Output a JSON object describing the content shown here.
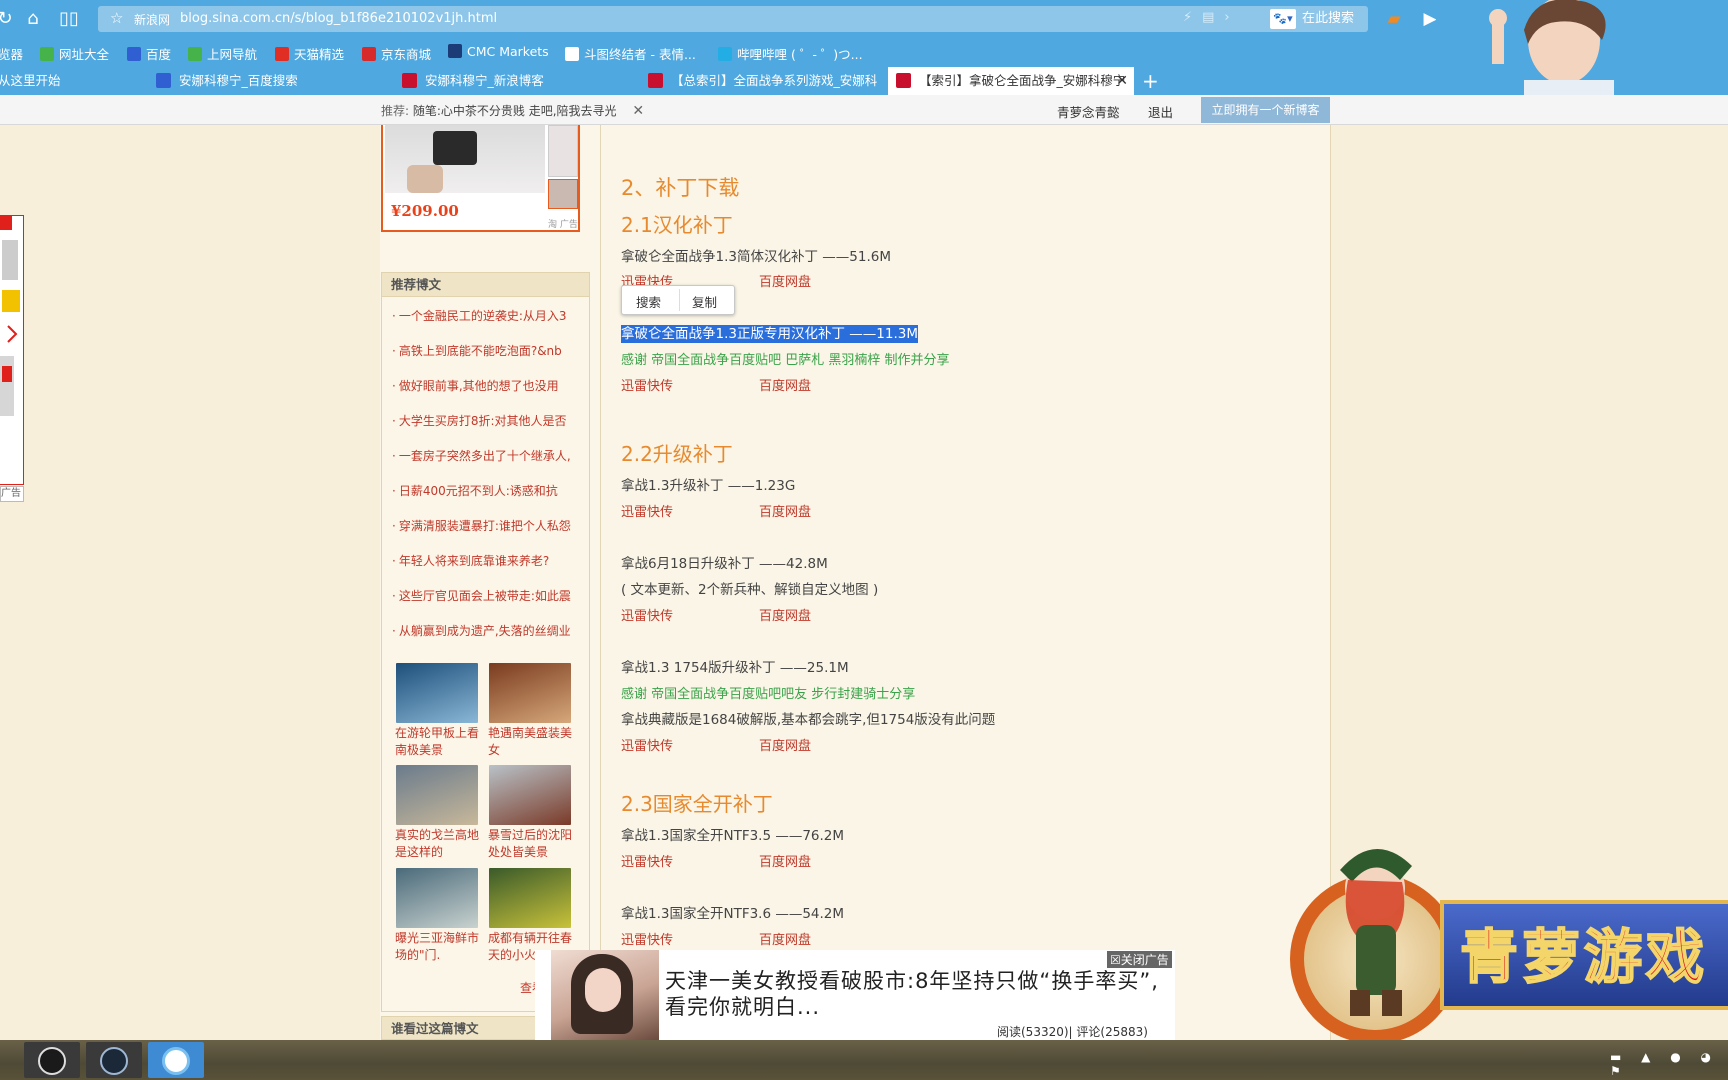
{
  "browser": {
    "address": {
      "site_label": "新浪网",
      "url": "blog.sina.com.cn/s/blog_b1f86e210102v1jh.html"
    },
    "search": {
      "placeholder": "在此搜索"
    },
    "bookmarks": [
      {
        "label": "览器",
        "icon": "doc-icon",
        "color": "#ffffff"
      },
      {
        "label": "网址大全",
        "icon": "leaf-icon",
        "color": "#46b34a"
      },
      {
        "label": "百度",
        "icon": "baidu-paw-icon",
        "color": "#2f5fd0"
      },
      {
        "label": "上网导航",
        "icon": "leaf-icon",
        "color": "#46b34a"
      },
      {
        "label": "天猫精选",
        "icon": "tmall-icon",
        "color": "#e02e24"
      },
      {
        "label": "京东商城",
        "icon": "jd-icon",
        "color": "#d72b2b"
      },
      {
        "label": "CMC Markets",
        "icon": "chart-icon",
        "color": "#1c3c78"
      },
      {
        "label": "斗图终结者 - 表情...",
        "icon": "doutu-icon",
        "color": "#ffffff"
      },
      {
        "label": "哔哩哔哩 ( ゜- ゜)つ...",
        "icon": "bilibili-icon",
        "color": "#23ade5"
      }
    ],
    "tabs": [
      {
        "label": "从这里开始",
        "icon": "",
        "color": ""
      },
      {
        "label": "安娜科穆宁_百度搜索",
        "icon": "baidu-paw-icon",
        "color": "#2f5fd0"
      },
      {
        "label": "安娜科穆宁_新浪博客",
        "icon": "sina-icon",
        "color": "#c8102e"
      },
      {
        "label": "【总索引】全面战争系列游戏_安娜科",
        "icon": "sina-icon",
        "color": "#c8102e"
      },
      {
        "label": "【索引】拿破仑全面战争_安娜科穆宁",
        "icon": "sina-icon",
        "color": "#c8102e"
      }
    ]
  },
  "blog_bar": {
    "recommend_prefix": "推荐:",
    "recommend_text": "随笔:心中茶不分贵贱  走吧,陪我去寻光",
    "username": "青萝念青懿",
    "logout": "退出",
    "new_blog": "立即拥有一个新博客"
  },
  "sidebar": {
    "product_price": "¥209.00",
    "product_tag": "淘 广告",
    "left_ad_label": "广告",
    "rec_header": "推荐博文",
    "rec_items": [
      "一个金融民工的逆袭史:从月入3",
      "高铁上到底能不能吃泡面?&nb",
      "做好眼前事,其他的想了也没用",
      "大学生买房打8折:对其他人是否",
      "一套房子突然多出了十个继承人,",
      "日薪400元招不到人:诱惑和抗",
      "穿满清服装遭暴打:谁把个人私怨",
      "年轻人将来到底靠谁来养老?",
      "这些厅官见面会上被带走:如此震",
      "从躺赢到成为遗产,失落的丝绸业"
    ],
    "thumbs": [
      {
        "caption": "在游轮甲板上看南极美景",
        "colors": [
          "#1d4f7a",
          "#8ab7d6"
        ]
      },
      {
        "caption": "艳遇南美盛装美女",
        "colors": [
          "#7a3b1f",
          "#d6a87a"
        ]
      },
      {
        "caption": "真实的戈兰高地是这样的",
        "colors": [
          "#6a7b8c",
          "#c8b89a"
        ]
      },
      {
        "caption": "暴雪过后的沈阳处处皆美景",
        "colors": [
          "#b9c2c8",
          "#7a3a28"
        ]
      },
      {
        "caption": "曝光三亚海鲜市场的\"门.",
        "colors": [
          "#4a6a7a",
          "#c9d2cf"
        ]
      },
      {
        "caption": "成都有辆开往春天的小火",
        "colors": [
          "#3a5a2a",
          "#c9c23a"
        ]
      }
    ],
    "more_link": "查看",
    "who_viewed": "谁看过这篇博文"
  },
  "article": {
    "h2": "2、补丁下载",
    "sections": [
      {
        "title": "2.1汉化补丁"
      },
      {
        "title": "2.2升级补丁"
      },
      {
        "title": "2.3国家全开补丁"
      }
    ],
    "lines": {
      "l1": "拿破仑全面战争1.3简体汉化补丁 ——51.6M",
      "l2_selected": "拿破仑全面战争1.3正版专用汉化补丁 ——11.3M",
      "l2_thanks": "感谢 帝国全面战争百度贴吧 巴萨札 黑羽楠梓 制作并分享",
      "l3": "拿战1.3升级补丁 ——1.23G",
      "l4": "拿战6月18日升级补丁 ——42.8M",
      "l4_note": "( 文本更新、2个新兵种、解锁自定义地图 )",
      "l5": "拿战1.3 1754版升级补丁 ——25.1M",
      "l5_thanks": "感谢 帝国全面战争百度贴吧吧友 步行封建骑士分享",
      "l5_note": "拿战典藏版是1684破解版,基本都会跳字,但1754版没有此问题",
      "l6": "拿战1.3国家全开NTF3.5 ——76.2M",
      "l7": "拿战1.3国家全开NTF3.6 ——54.2M"
    },
    "link_thunder": "迅雷快传",
    "link_baidu": "百度网盘",
    "ctx_menu": {
      "search": "搜索",
      "copy": "复制"
    }
  },
  "news_ad": {
    "close": "☒关闭广告",
    "title": "天津一美女教授看破股市:8年坚持只做“换手率买”,看完你就明白...",
    "stats": "阅读(53320)| 评论(25883)"
  },
  "mascot": {
    "logo_text": "青萝游戏"
  },
  "colors": {
    "chrome": "#4fa8df",
    "page_bg": "#faf5e6",
    "heading": "#e78a2f",
    "link": "#c0392b",
    "thanks": "#3aa34a",
    "selection": "#2a6edc"
  }
}
